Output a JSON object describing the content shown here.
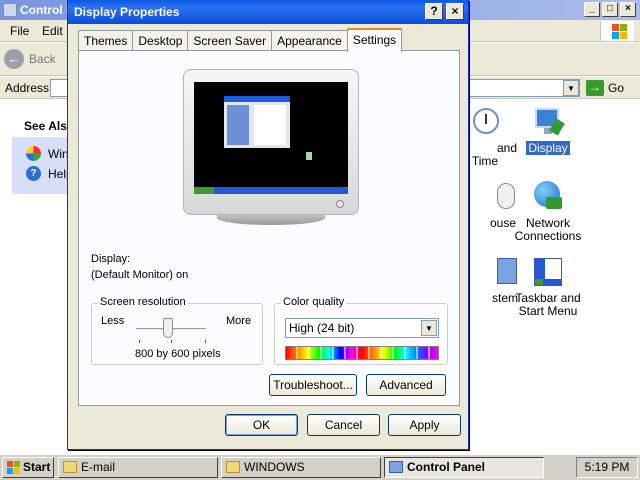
{
  "control_panel": {
    "title": "Control P",
    "menu": [
      "File",
      "Edit"
    ],
    "toolbar": {
      "back_label": "Back"
    },
    "address": {
      "label": "Address",
      "go_label": "Go"
    },
    "see_also": {
      "heading": "See Als",
      "items": [
        {
          "label": "Win",
          "icon": "windows-update-icon"
        },
        {
          "label": "Help",
          "icon": "help-icon"
        }
      ]
    },
    "icons": [
      {
        "label": "and Time",
        "icon": "date-time-icon"
      },
      {
        "label": "Display",
        "icon": "display-icon",
        "selected": true
      },
      {
        "label": "ouse",
        "icon": "mouse-icon"
      },
      {
        "label": "Network Connections",
        "icon": "network-connections-icon"
      },
      {
        "label": "stem",
        "icon": "system-icon"
      },
      {
        "label": "Taskbar and Start Menu",
        "icon": "taskbar-start-menu-icon"
      }
    ],
    "window_controls": [
      "_",
      "□",
      "×"
    ]
  },
  "dialog": {
    "title": "Display Properties",
    "title_buttons": {
      "help": "?",
      "close": "×"
    },
    "tabs": [
      "Themes",
      "Desktop",
      "Screen Saver",
      "Appearance",
      "Settings"
    ],
    "active_tab": "Settings",
    "display_label": "Display:",
    "display_value": "(Default Monitor) on",
    "screen_resolution": {
      "legend": "Screen resolution",
      "less": "Less",
      "more": "More",
      "value": "800 by 600 pixels",
      "slider_level": 0.45
    },
    "color_quality": {
      "legend": "Color quality",
      "selected": "High (24 bit)"
    },
    "buttons": {
      "troubleshoot": "Troubleshoot...",
      "advanced": "Advanced",
      "ok": "OK",
      "cancel": "Cancel",
      "apply": "Apply"
    }
  },
  "taskbar": {
    "start": "Start",
    "tasks": [
      {
        "label": "E-mail",
        "icon": "folder-icon",
        "active": false
      },
      {
        "label": "WINDOWS",
        "icon": "folder-icon",
        "active": false
      },
      {
        "label": "Control Panel",
        "icon": "control-panel-icon",
        "active": true
      }
    ],
    "clock": "5:19 PM"
  },
  "colors": {
    "dialog_title": "#0a58e7",
    "dialog_face": "#ece9d8",
    "selection": "#316ac5",
    "active_tab_accent": "#e68b2c"
  }
}
